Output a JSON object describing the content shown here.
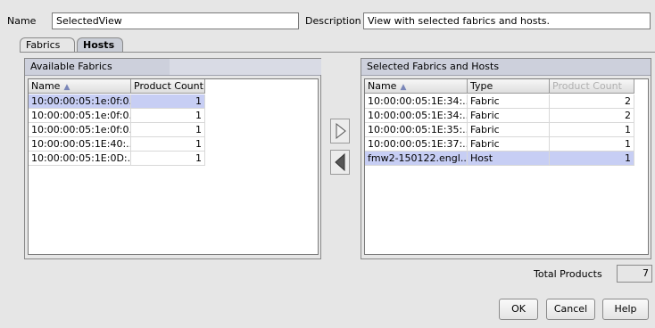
{
  "form": {
    "name_label": "Name",
    "name_value": "SelectedView",
    "description_label": "Description",
    "description_value": "View with selected fabrics and hosts."
  },
  "tabs": [
    {
      "label": "Fabrics",
      "active": true
    },
    {
      "label": "Hosts",
      "active": false
    }
  ],
  "available": {
    "title": "Available Fabrics",
    "columns": [
      "Name",
      "Product Count"
    ],
    "rows": [
      {
        "name": "10:00:00:05:1e:0f:0...",
        "count": "1",
        "selected": true
      },
      {
        "name": "10:00:00:05:1e:0f:0...",
        "count": "1",
        "selected": false
      },
      {
        "name": "10:00:00:05:1e:0f:0...",
        "count": "1",
        "selected": false
      },
      {
        "name": "10:00:00:05:1E:40:...",
        "count": "1",
        "selected": false
      },
      {
        "name": "10:00:00:05:1E:0D:...",
        "count": "1",
        "selected": false
      }
    ]
  },
  "selected": {
    "title": "Selected Fabrics and Hosts",
    "columns": [
      "Name",
      "Type",
      "Product Count"
    ],
    "rows": [
      {
        "name": "10:00:00:05:1E:34:...",
        "type": "Fabric",
        "count": "2",
        "selected": false
      },
      {
        "name": "10:00:00:05:1E:34:...",
        "type": "Fabric",
        "count": "2",
        "selected": false
      },
      {
        "name": "10:00:00:05:1E:35:...",
        "type": "Fabric",
        "count": "1",
        "selected": false
      },
      {
        "name": "10:00:00:05:1E:37:...",
        "type": "Fabric",
        "count": "1",
        "selected": false
      },
      {
        "name": "fmw2-150122.engl...",
        "type": "Host",
        "count": "1",
        "selected": true
      }
    ]
  },
  "totals": {
    "label": "Total Products",
    "value": "7"
  },
  "buttons": {
    "ok": "OK",
    "cancel": "Cancel",
    "help": "Help"
  },
  "icons": {
    "add": "triangle-right-icon",
    "remove": "triangle-left-icon",
    "sort": "sort-ascending-icon"
  },
  "colors": {
    "selection": "#c7cef4",
    "panel_header": "#cdd0dc"
  }
}
